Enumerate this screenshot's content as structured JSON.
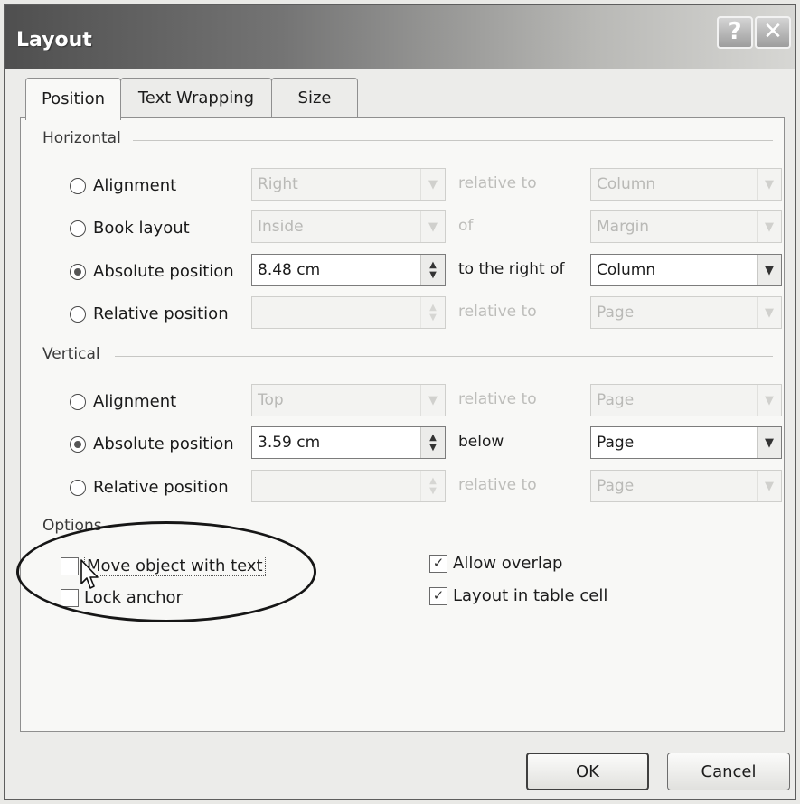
{
  "window": {
    "title": "Layout",
    "help_button": "?",
    "close_button": "✕"
  },
  "tabs": [
    {
      "label": "Position",
      "active": true
    },
    {
      "label": "Text Wrapping",
      "active": false
    },
    {
      "label": "Size",
      "active": false
    }
  ],
  "horizontal": {
    "section_label": "Horizontal",
    "rows": [
      {
        "label": "Alignment",
        "checked": false,
        "value": "Right",
        "relation": "relative to",
        "target": "Column",
        "enabled": false
      },
      {
        "label": "Book layout",
        "checked": false,
        "value": "Inside",
        "relation": "of",
        "target": "Margin",
        "enabled": false
      },
      {
        "label": "Absolute position",
        "checked": true,
        "value": "8.48 cm",
        "relation": "to the right of",
        "target": "Column",
        "enabled": true
      },
      {
        "label": "Relative position",
        "checked": false,
        "value": "",
        "relation": "relative to",
        "target": "Page",
        "enabled": false
      }
    ]
  },
  "vertical": {
    "section_label": "Vertical",
    "rows": [
      {
        "label": "Alignment",
        "checked": false,
        "value": "Top",
        "relation": "relative to",
        "target": "Page",
        "enabled": false
      },
      {
        "label": "Absolute position",
        "checked": true,
        "value": "3.59 cm",
        "relation": "below",
        "target": "Page",
        "enabled": true
      },
      {
        "label": "Relative position",
        "checked": false,
        "value": "",
        "relation": "relative to",
        "target": "Page",
        "enabled": false
      }
    ]
  },
  "options": {
    "section_label": "Options",
    "move_object_with_text": {
      "label": "Move object with text",
      "checked": false
    },
    "lock_anchor": {
      "label": "Lock anchor",
      "checked": false
    },
    "allow_overlap": {
      "label": "Allow overlap",
      "checked": true
    },
    "layout_in_table_cell": {
      "label": "Layout in table cell",
      "checked": true
    }
  },
  "buttons": {
    "ok": "OK",
    "cancel": "Cancel"
  },
  "icons": {
    "dropdown": "chevron-down-icon",
    "spinner": "spinner-arrows-icon",
    "cursor": "mouse-pointer-icon",
    "check": "checkmark-icon"
  }
}
